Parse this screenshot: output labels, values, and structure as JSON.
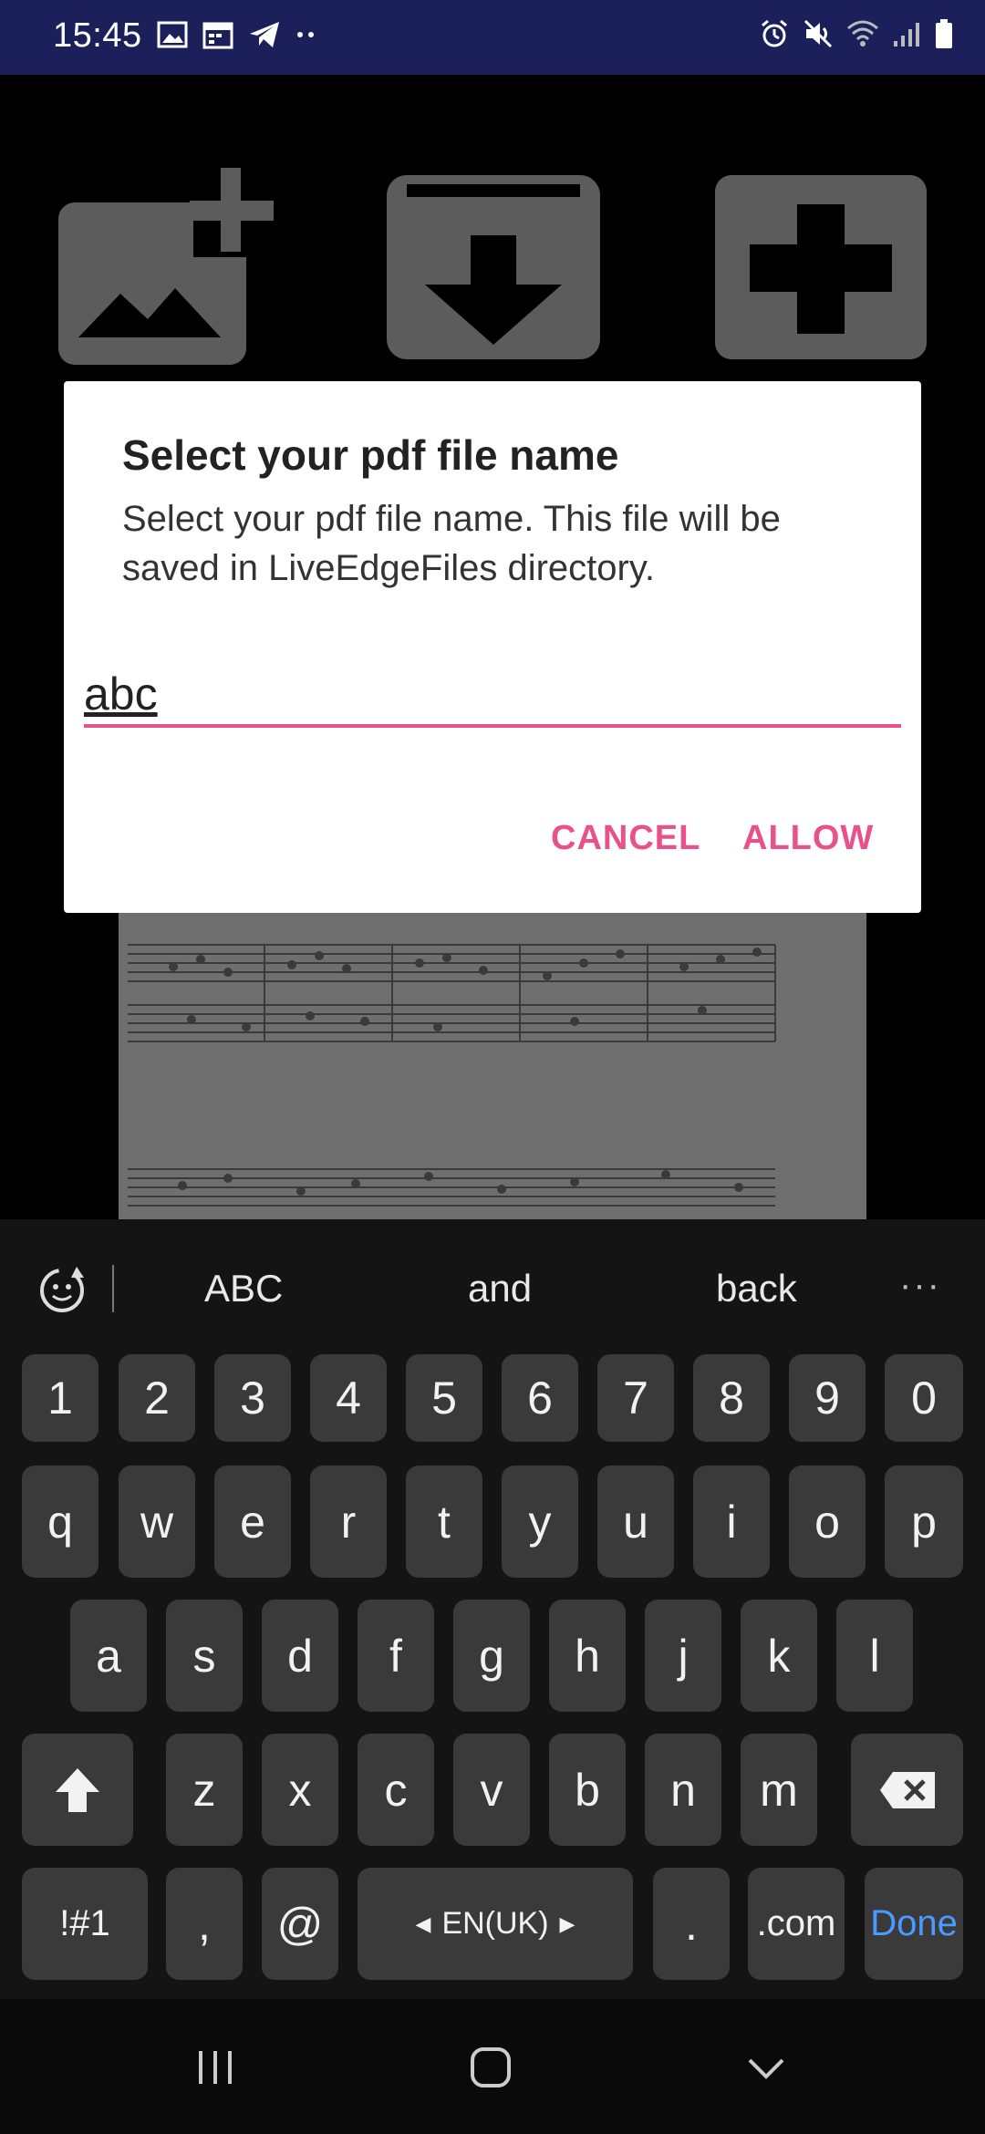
{
  "status_bar": {
    "time": "15:45",
    "left_icons": [
      "image-icon",
      "calendar-icon",
      "telegram-icon",
      "more-dots-icon"
    ],
    "right_icons": [
      "alarm-icon",
      "mute-icon",
      "wifi-icon",
      "signal-icon",
      "battery-icon"
    ]
  },
  "app": {
    "toolbar_icons": [
      "add-image-icon",
      "download-archive-icon",
      "add-icon"
    ]
  },
  "dialog": {
    "title": "Select your pdf file name",
    "message": "Select your pdf file name. This file will be saved in LiveEdgeFiles directory.",
    "input_value": "abc",
    "cancel_label": "CANCEL",
    "allow_label": "ALLOW",
    "accent_color": "#e8518b"
  },
  "keyboard": {
    "suggestions": [
      "ABC",
      "and",
      "back"
    ],
    "more": "···",
    "row_numbers": [
      "1",
      "2",
      "3",
      "4",
      "5",
      "6",
      "7",
      "8",
      "9",
      "0"
    ],
    "row_q": [
      "q",
      "w",
      "e",
      "r",
      "t",
      "y",
      "u",
      "i",
      "o",
      "p"
    ],
    "row_a": [
      "a",
      "s",
      "d",
      "f",
      "g",
      "h",
      "j",
      "k",
      "l"
    ],
    "row_z": [
      "z",
      "x",
      "c",
      "v",
      "b",
      "n",
      "m"
    ],
    "symbols_label": "!#1",
    "comma_label": ",",
    "at_label": "@",
    "space_label": "EN(UK)",
    "period_label": ".",
    "dotcom_label": ".com",
    "done_label": "Done"
  },
  "nav_bar": {
    "buttons": [
      "recent-apps-icon",
      "home-icon",
      "back-icon"
    ]
  }
}
